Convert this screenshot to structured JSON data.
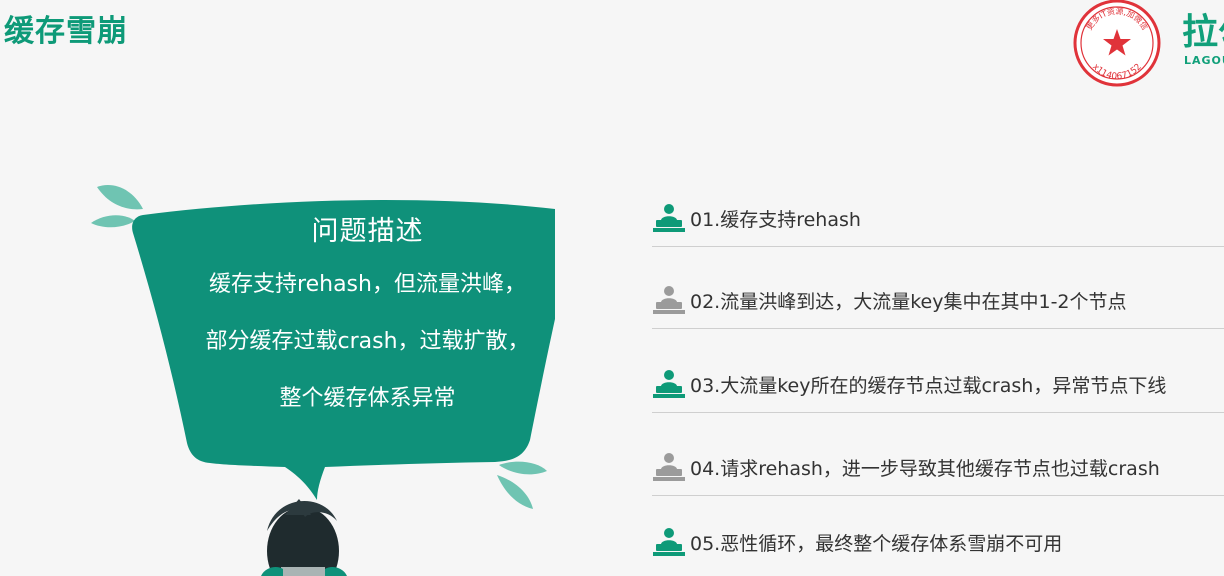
{
  "slide": {
    "title": "缓存雪崩",
    "stamp": {
      "top_text": "更多IT资源,加微信",
      "bottom_text": "x114067152"
    },
    "brand": {
      "cn": "拉勾",
      "en": "LAGOU"
    }
  },
  "bubble": {
    "heading": "问题描述",
    "lines": [
      "缓存支持rehash，但流量洪峰，",
      "部分缓存过载crash，过载扩散，",
      "整个缓存体系异常"
    ]
  },
  "points": [
    {
      "text": "01.缓存支持rehash",
      "icon": "speaker-podium-icon",
      "icon_color": "#0e9a78"
    },
    {
      "text": "02.流量洪峰到达，大流量key集中在其中1-2个节点",
      "icon": "speaker-podium-icon",
      "icon_color": "#9b9b9b"
    },
    {
      "text": "03.大流量key所在的缓存节点过载crash，异常节点下线",
      "icon": "speaker-podium-icon",
      "icon_color": "#0e9a78"
    },
    {
      "text": "04.请求rehash，进一步导致其他缓存节点也过载crash",
      "icon": "speaker-podium-icon",
      "icon_color": "#9b9b9b"
    },
    {
      "text": "05.恶性循环，最终整个缓存体系雪崩不可用",
      "icon": "speaker-podium-icon",
      "icon_color": "#0e9a78"
    }
  ],
  "colors": {
    "accent": "#0e9a78",
    "bubble": "#0f917a",
    "muted_icon": "#9b9b9b",
    "stamp": "#e0333a"
  }
}
